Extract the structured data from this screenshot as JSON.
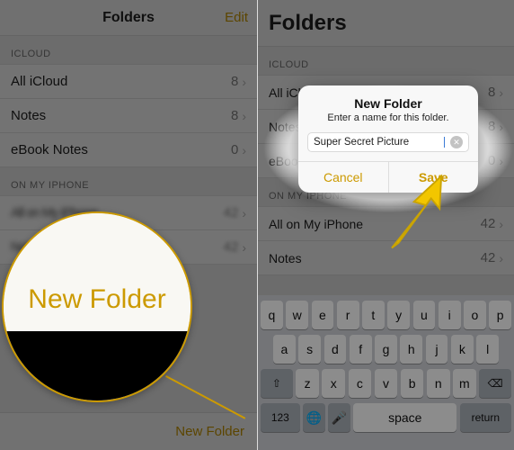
{
  "left": {
    "nav_title": "Folders",
    "edit_label": "Edit",
    "section_icloud": "ICLOUD",
    "rows_icloud": [
      {
        "label": "All iCloud",
        "count": "8"
      },
      {
        "label": "Notes",
        "count": "8"
      },
      {
        "label": "eBook Notes",
        "count": "0"
      }
    ],
    "section_local": "ON MY IPHONE",
    "rows_local": [
      {
        "label": "All on My iPhone",
        "count": "42"
      },
      {
        "label": "Notes",
        "count": "42"
      }
    ],
    "new_folder_label": "New Folder",
    "magnifier_text": "New Folder",
    "chevron": "›"
  },
  "right": {
    "nav_title": "Folders",
    "section_icloud": "ICLOUD",
    "rows_icloud": [
      {
        "label": "All iCloud",
        "count": "8"
      },
      {
        "label": "Notes",
        "count": "8"
      },
      {
        "label": "eBook Notes",
        "count": "0"
      }
    ],
    "section_local": "ON MY IPHONE",
    "rows_local": [
      {
        "label": "All on My iPhone",
        "count": "42"
      },
      {
        "label": "Notes",
        "count": "42"
      }
    ],
    "chevron": "›"
  },
  "dialog": {
    "title": "New Folder",
    "subtitle": "Enter a name for this folder.",
    "input_value": "Super Secret Picture",
    "cancel": "Cancel",
    "save": "Save"
  },
  "keyboard": {
    "row1": [
      "q",
      "w",
      "e",
      "r",
      "t",
      "y",
      "u",
      "i",
      "o",
      "p"
    ],
    "row2": [
      "a",
      "s",
      "d",
      "f",
      "g",
      "h",
      "j",
      "k",
      "l"
    ],
    "row3": [
      "z",
      "x",
      "c",
      "v",
      "b",
      "n",
      "m"
    ],
    "num": "123",
    "space": "space",
    "return": "return",
    "shift": "⇧",
    "backspace": "⌫",
    "globe": "🌐",
    "mic": "🎤"
  }
}
